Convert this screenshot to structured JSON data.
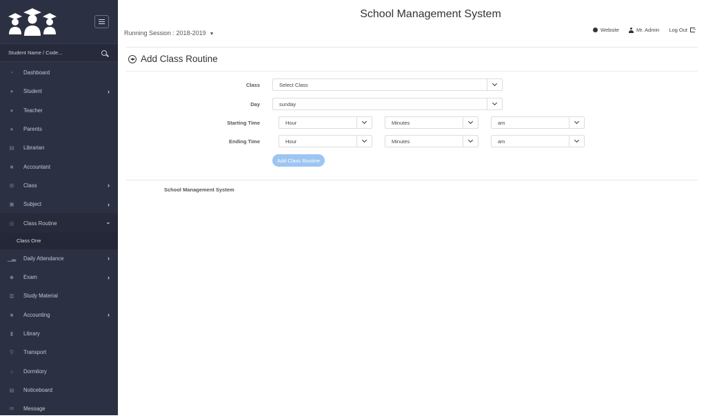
{
  "header": {
    "app_title": "School Management System",
    "session_label": "Running Session : 2018-2019",
    "links": {
      "website": "Website",
      "user": "Mr. Admin",
      "logout": "Log Out"
    }
  },
  "sidebar": {
    "search_placeholder": "Student Name / Code...",
    "items": [
      {
        "label": "Dashboard",
        "icon": "dashboard-icon",
        "has_children": false
      },
      {
        "label": "Student",
        "icon": "users-icon",
        "has_children": true
      },
      {
        "label": "Teacher",
        "icon": "teacher-icon",
        "has_children": false
      },
      {
        "label": "Parents",
        "icon": "user-icon",
        "has_children": false
      },
      {
        "label": "Librarian",
        "icon": "book-icon",
        "has_children": false
      },
      {
        "label": "Accountant",
        "icon": "briefcase-icon",
        "has_children": false
      },
      {
        "label": "Class",
        "icon": "sitemap-icon",
        "has_children": true
      },
      {
        "label": "Subject",
        "icon": "subject-icon",
        "has_children": true
      },
      {
        "label": "Class Routine",
        "icon": "routine-icon",
        "has_children": true,
        "expanded": true
      },
      {
        "label": "Daily Attendance",
        "icon": "chart-icon",
        "has_children": true
      },
      {
        "label": "Exam",
        "icon": "graduation-cap-icon",
        "has_children": true
      },
      {
        "label": "Study Material",
        "icon": "study-material-icon",
        "has_children": false
      },
      {
        "label": "Accounting",
        "icon": "accounting-icon",
        "has_children": true
      },
      {
        "label": "Library",
        "icon": "library-icon",
        "has_children": false
      },
      {
        "label": "Transport",
        "icon": "map-marker-icon",
        "has_children": false
      },
      {
        "label": "Dormitory",
        "icon": "home-icon",
        "has_children": false
      },
      {
        "label": "Noticeboard",
        "icon": "noticeboard-icon",
        "has_children": false
      },
      {
        "label": "Message",
        "icon": "envelope-icon",
        "has_children": false
      }
    ],
    "sub_items": {
      "class_routine": [
        "Class One"
      ]
    }
  },
  "page": {
    "title": "Add Class Routine",
    "form": {
      "class_label": "Class",
      "class_value": "Select Class",
      "day_label": "Day",
      "day_value": "sunday",
      "start_label": "Starting Time",
      "start_hour": "Hour",
      "start_minutes": "Minutes",
      "start_ampm": "am",
      "end_label": "Ending Time",
      "end_hour": "Hour",
      "end_minutes": "Minutes",
      "end_ampm": "am",
      "submit_label": "Add Class Routine"
    },
    "footer": "School Management System"
  },
  "colors": {
    "sidebar_bg": "#2b3042",
    "button_bg": "#9cc5f2"
  }
}
